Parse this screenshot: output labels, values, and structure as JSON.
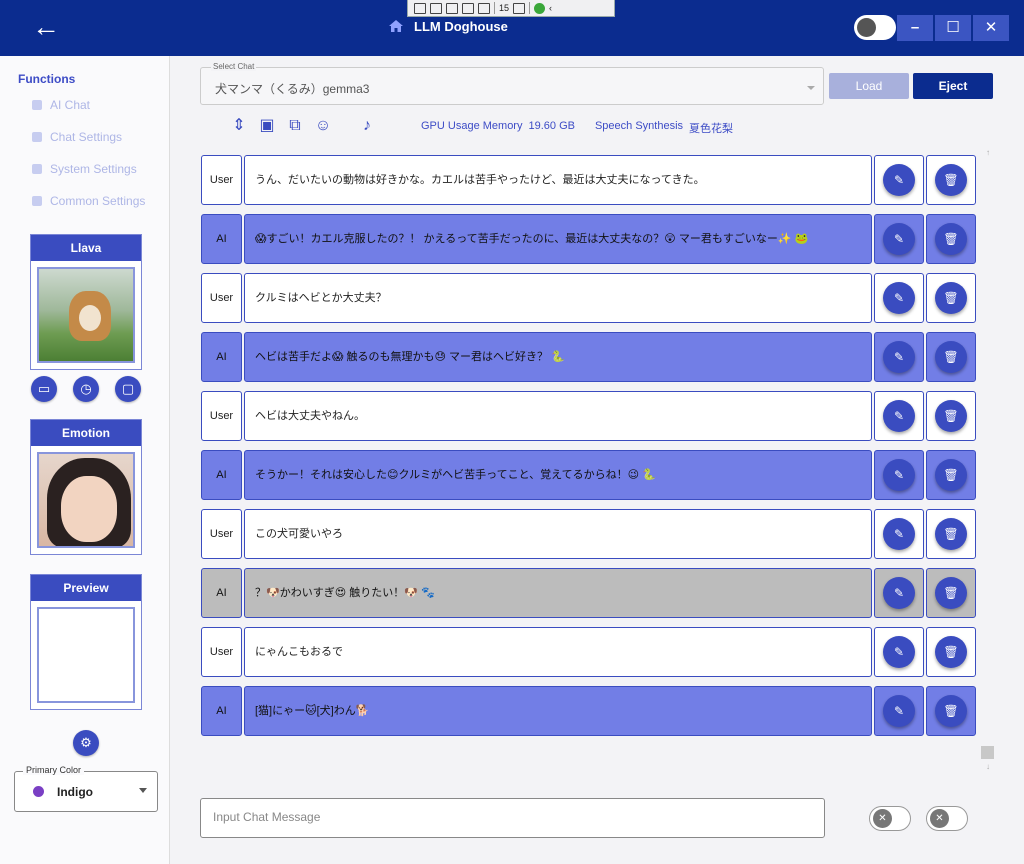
{
  "app": {
    "title": "LLM Doghouse"
  },
  "debug_toolbar": {
    "count": "15"
  },
  "window_buttons": {
    "minimize": "–",
    "maximize": "☐",
    "close": "✕"
  },
  "sidebar": {
    "section_label": "Functions",
    "items": [
      {
        "label": "AI Chat"
      },
      {
        "label": "Chat Settings"
      },
      {
        "label": "System Settings"
      },
      {
        "label": "Common Settings"
      }
    ],
    "panels": {
      "llava": "Llava",
      "emotion": "Emotion",
      "preview": "Preview"
    },
    "primary_color": {
      "label": "Primary Color",
      "value": "Indigo"
    }
  },
  "chat_select": {
    "label": "Select Chat",
    "value": "犬マンマ（くるみ）gemma3",
    "load": "Load",
    "eject": "Eject"
  },
  "status": {
    "gpu_label": "GPU Usage Memory",
    "gpu_value": "19.60 GB",
    "speech_label": "Speech Synthesis",
    "speech_value": "夏色花梨"
  },
  "messages": [
    {
      "role": "User",
      "text": "うん、だいたいの動物は好きかな。カエルは苦手やったけど、最近は大丈夫になってきた。"
    },
    {
      "role": "AI",
      "text": "😱すごい！カエル克服したの？！ かえるって苦手だったのに、最近は大丈夫なの？😲 マー君もすごいなー✨ 🐸"
    },
    {
      "role": "User",
      "text": "クルミはヘビとか大丈夫？"
    },
    {
      "role": "AI",
      "text": "ヘビは苦手だよ😱 触るのも無理かも😓 マー君はヘビ好き？ 🐍"
    },
    {
      "role": "User",
      "text": "ヘビは大丈夫やねん。"
    },
    {
      "role": "AI",
      "text": "そうかー！それは安心した😊クルミがヘビ苦手ってこと、覚えてるからね！😉 🐍"
    },
    {
      "role": "User",
      "text": "この犬可愛いやろ"
    },
    {
      "role": "AI",
      "text": "？🐶かわいすぎ😍 触りたい！🐶 🐾"
    },
    {
      "role": "User",
      "text": "にゃんこもおるで"
    },
    {
      "role": "AI",
      "text": "[猫]にゃー🐱[犬]わん🐕"
    }
  ],
  "input": {
    "placeholder": "Input Chat Message"
  },
  "colors": {
    "title_bar": "#0b2c8f",
    "primary": "#3a4cc0",
    "ai_bubble": "#727ee6",
    "selected_bubble": "#bcbcbc"
  }
}
